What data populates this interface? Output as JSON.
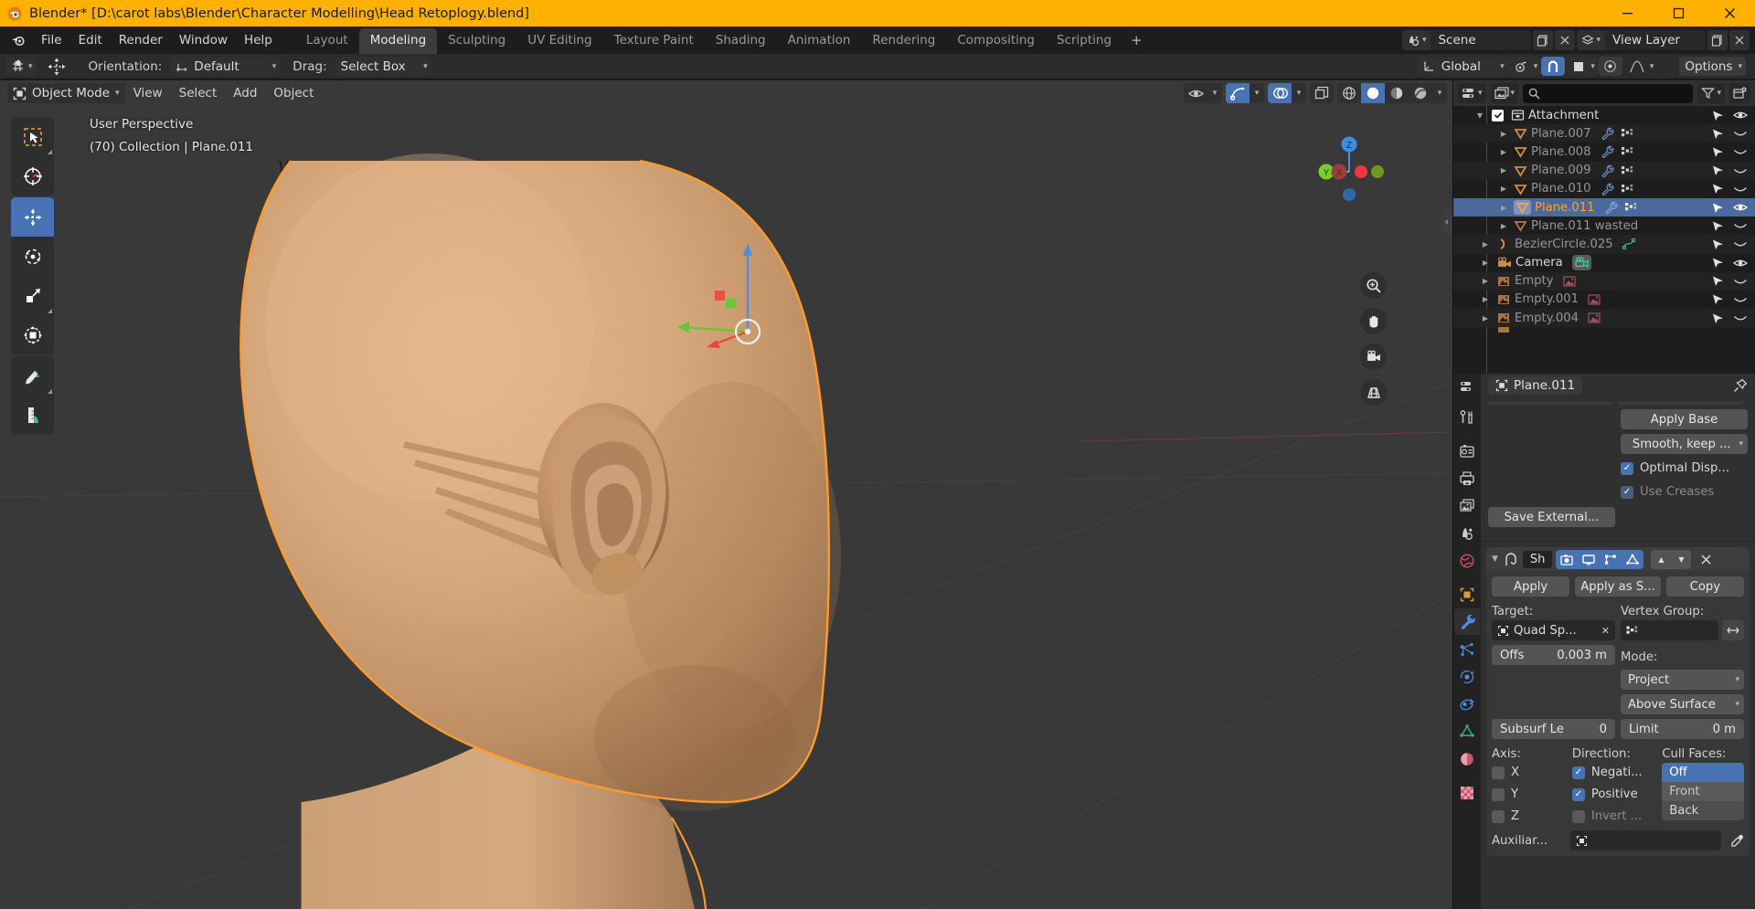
{
  "window": {
    "title": "Blender* [D:\\carot labs\\Blender\\Character Modelling\\Head Retoplogy.blend]",
    "minimize": "—",
    "maximize": "❐",
    "close": "✕"
  },
  "topbar": {
    "menus": [
      "File",
      "Edit",
      "Render",
      "Window",
      "Help"
    ],
    "workspaces": [
      {
        "label": "Layout",
        "active": false
      },
      {
        "label": "Modeling",
        "active": true
      },
      {
        "label": "Sculpting",
        "active": false
      },
      {
        "label": "UV Editing",
        "active": false
      },
      {
        "label": "Texture Paint",
        "active": false
      },
      {
        "label": "Shading",
        "active": false
      },
      {
        "label": "Animation",
        "active": false
      },
      {
        "label": "Rendering",
        "active": false
      },
      {
        "label": "Compositing",
        "active": false
      },
      {
        "label": "Scripting",
        "active": false
      }
    ],
    "add_workspace": "+",
    "scene_name": "Scene",
    "view_layer_name": "View Layer"
  },
  "toolsettings": {
    "orientation_label": "Orientation:",
    "orientation_value": "Default",
    "drag_label": "Drag:",
    "drag_value": "Select Box",
    "transform_orientation": "Global",
    "options_label": "Options"
  },
  "viewport": {
    "mode": "Object Mode",
    "menus": [
      "View",
      "Select",
      "Add",
      "Object"
    ],
    "overlay_line1": "User Perspective",
    "overlay_line2": "(70) Collection | Plane.011",
    "gizmo_axes": [
      "X",
      "Y",
      "Z"
    ],
    "accent_orange": "#ff9a2b",
    "bg_color": "#393939"
  },
  "outliner": {
    "search_placeholder": "",
    "search_value": "",
    "rows": [
      {
        "name": "Attachment",
        "indent": 1,
        "type": "collection",
        "expand": "▼",
        "checkbox": true,
        "style": "bright",
        "selected": false,
        "eye": "open",
        "mid": []
      },
      {
        "name": "Plane.007",
        "indent": 2,
        "type": "mesh",
        "expand": "▶",
        "checkbox": false,
        "style": "normal",
        "selected": false,
        "eye": "closed",
        "mid": [
          "wrench",
          "data"
        ]
      },
      {
        "name": "Plane.008",
        "indent": 2,
        "type": "mesh",
        "expand": "▶",
        "checkbox": false,
        "style": "normal",
        "selected": false,
        "eye": "closed",
        "mid": [
          "wrench",
          "data"
        ]
      },
      {
        "name": "Plane.009",
        "indent": 2,
        "type": "mesh",
        "expand": "▶",
        "checkbox": false,
        "style": "normal",
        "selected": false,
        "eye": "closed",
        "mid": [
          "wrench",
          "data"
        ]
      },
      {
        "name": "Plane.010",
        "indent": 2,
        "type": "mesh",
        "expand": "▶",
        "checkbox": false,
        "style": "normal",
        "selected": false,
        "eye": "closed",
        "mid": [
          "wrench",
          "data"
        ]
      },
      {
        "name": "Plane.011",
        "indent": 2,
        "type": "mesh",
        "expand": "▶",
        "checkbox": false,
        "style": "sel",
        "selected": true,
        "eye": "open",
        "mid": [
          "wrench",
          "data"
        ]
      },
      {
        "name": "Plane.011  wasted",
        "indent": 2,
        "type": "mesh",
        "expand": "▶",
        "checkbox": false,
        "style": "normal",
        "selected": false,
        "eye": "closed",
        "mid": []
      },
      {
        "name": "BezierCircle.025",
        "indent": 1,
        "type": "curve",
        "expand": "▶",
        "checkbox": false,
        "style": "normal",
        "selected": false,
        "eye": "closed",
        "mid": [
          "curvedata"
        ]
      },
      {
        "name": "Camera",
        "indent": 1,
        "type": "camera",
        "expand": "▶",
        "checkbox": false,
        "style": "bright",
        "selected": false,
        "eye": "open",
        "mid": [
          "camdata"
        ]
      },
      {
        "name": "Empty",
        "indent": 1,
        "type": "empty",
        "expand": "▶",
        "checkbox": false,
        "style": "normal",
        "selected": false,
        "eye": "closed",
        "mid": [
          "imgdata"
        ]
      },
      {
        "name": "Empty.001",
        "indent": 1,
        "type": "empty",
        "expand": "▶",
        "checkbox": false,
        "style": "normal",
        "selected": false,
        "eye": "closed",
        "mid": [
          "imgdata"
        ]
      },
      {
        "name": "Empty.004",
        "indent": 1,
        "type": "empty",
        "expand": "▶",
        "checkbox": false,
        "style": "normal",
        "selected": false,
        "eye": "closed",
        "mid": [
          "imgdata"
        ]
      }
    ]
  },
  "properties": {
    "breadcrumb_object": "Plane.011",
    "subsurf": {
      "apply_base": "Apply Base",
      "uv_smooth": "Smooth, keep ...",
      "optimal_display": "Optimal Disp...",
      "use_creases": "Use Creases",
      "save_external": "Save External..."
    },
    "modifier": {
      "name": "Sh",
      "apply": "Apply",
      "apply_as_shape": "Apply as S...",
      "copy": "Copy",
      "target_label": "Target:",
      "target_value": "Quad Sp...",
      "target_clear": "✕",
      "vertex_group_label": "Vertex Group:",
      "vertex_group_value": "",
      "offset_label": "Offs",
      "offset_value": "0.003 m",
      "mode_label": "Mode:",
      "mode_value": "Project",
      "snap_mode_value": "Above Surface",
      "subsurf_levels_label": "Subsurf Le",
      "subsurf_levels_value": "0",
      "limit_label": "Limit",
      "limit_value": "0 m",
      "axis_label": "Axis:",
      "axis_items": [
        {
          "label": "X",
          "checked": false
        },
        {
          "label": "Y",
          "checked": false
        },
        {
          "label": "Z",
          "checked": false
        }
      ],
      "direction_label": "Direction:",
      "direction_items": [
        {
          "label": "Negati...",
          "checked": true,
          "dim": false
        },
        {
          "label": "Positive",
          "checked": true,
          "dim": false
        },
        {
          "label": "Invert ...",
          "checked": false,
          "dim": true
        }
      ],
      "cull_label": "Cull Faces:",
      "cull_options": [
        {
          "label": "Off",
          "selected": true
        },
        {
          "label": "Front",
          "selected": false
        },
        {
          "label": "Back",
          "selected": false
        }
      ],
      "auxiliary_label": "Auxiliar...",
      "auxiliary_value": ""
    }
  },
  "colors": {
    "title_bg": "#ffb100",
    "accent_blue": "#4772b3",
    "selected_row": "#4b6a9b",
    "orange_text": "#ffa32b",
    "skin": "#d0a077"
  }
}
